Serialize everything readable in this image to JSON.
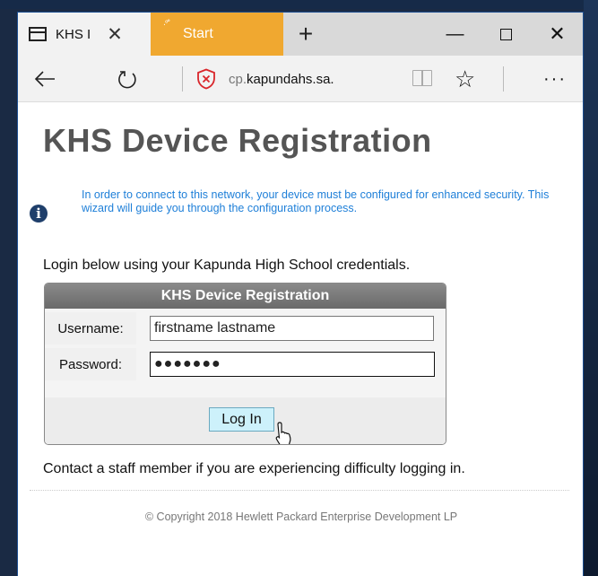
{
  "browser": {
    "tabs": [
      {
        "label": "KHS I",
        "close": "✕"
      },
      {
        "label": "Start"
      }
    ],
    "new_tab": "+",
    "window_controls": {
      "minimize": "—",
      "close": "✕"
    },
    "url_prefix": "cp.",
    "url_domain": "kapundahs.sa.",
    "more": "···",
    "icons": [
      "back-arrow-icon",
      "refresh-icon",
      "security-shield-icon",
      "reading-view-icon",
      "favorites-star-icon"
    ]
  },
  "page": {
    "title": "KHS Device Registration",
    "info": "In order to connect to this network, your device must be configured for enhanced security. This wizard will guide you through the configuration process.",
    "lead": "Login below using your Kapunda High School credentials.",
    "login_box": {
      "heading": "KHS Device Registration",
      "username_label": "Username:",
      "username_value": "firstname lastname",
      "password_label": "Password:",
      "password_value": "●●●●●●●",
      "button": "Log In"
    },
    "contact": "Contact a staff member if you are experiencing difficulty logging in.",
    "footer": "© Copyright 2018 Hewlett Packard Enterprise Development LP"
  },
  "colors": {
    "start_tab": "#f0a830",
    "info_text": "#1e7fd8",
    "button_bg": "#cdf1fb",
    "shield_red": "#d9262b"
  }
}
